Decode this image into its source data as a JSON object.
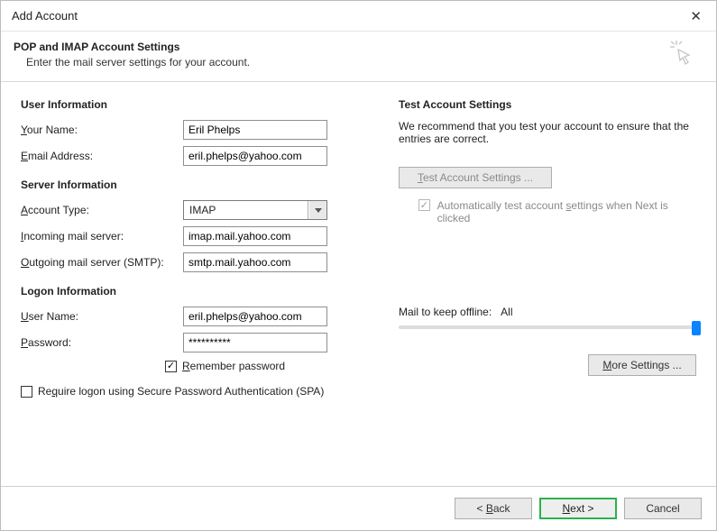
{
  "window": {
    "title": "Add Account"
  },
  "header": {
    "title": "POP and IMAP Account Settings",
    "subtitle": "Enter the mail server settings for your account."
  },
  "left": {
    "user_info_heading": "User Information",
    "your_name_label": "Your Name:",
    "your_name_value": "Eril Phelps",
    "email_label": "Email Address:",
    "email_value": "eril.phelps@yahoo.com",
    "server_info_heading": "Server Information",
    "account_type_label": "Account Type:",
    "account_type_value": "IMAP",
    "incoming_label": "Incoming mail server:",
    "incoming_value": "imap.mail.yahoo.com",
    "outgoing_label": "Outgoing mail server (SMTP):",
    "outgoing_value": "smtp.mail.yahoo.com",
    "logon_heading": "Logon Information",
    "user_name_label": "User Name:",
    "user_name_value": "eril.phelps@yahoo.com",
    "password_label": "Password:",
    "password_value": "**********",
    "remember_label": "Remember password",
    "spa_label": "Require logon using Secure Password Authentication (SPA)"
  },
  "right": {
    "heading": "Test Account Settings",
    "intro": "We recommend that you test your account to ensure that the entries are correct.",
    "test_btn": "Test Account Settings ...",
    "auto_test_label": "Automatically test account settings when Next is clicked",
    "slider_label": "Mail to keep offline:",
    "slider_value": "All",
    "more_settings": "More Settings ..."
  },
  "footer": {
    "back": "< Back",
    "next": "Next >",
    "cancel": "Cancel"
  }
}
